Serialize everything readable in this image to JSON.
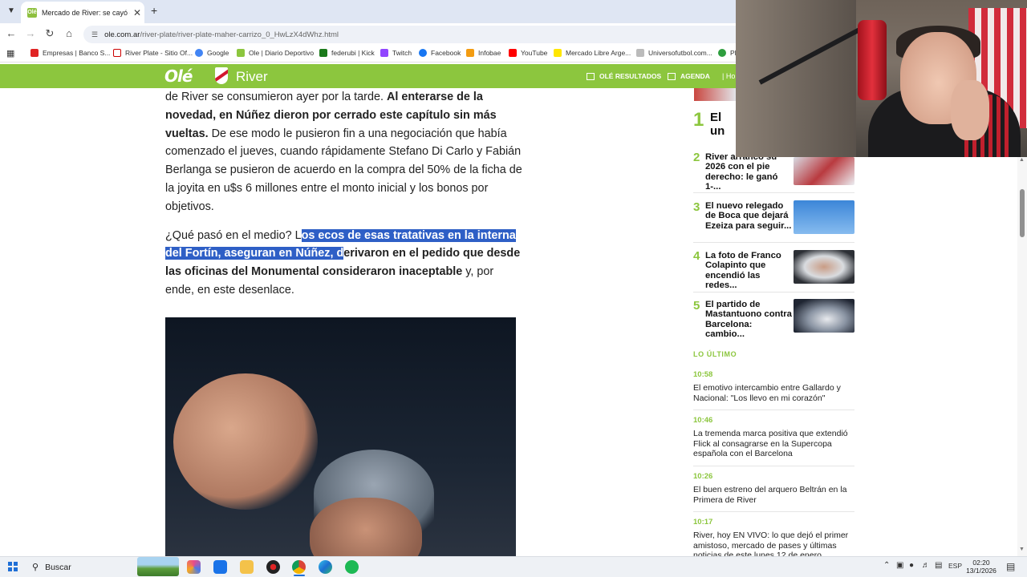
{
  "browser": {
    "tab_title": "Mercado de River: se cayó el pa",
    "tab_favicon": "Olé",
    "url_domain": "ole.com.ar",
    "url_path": "/river-plate/river-plate-maher-carrizo_0_HwLzX4dWhz.html",
    "bookmarks": [
      {
        "label": "Empresas | Banco S...",
        "color": "#e02424"
      },
      {
        "label": "River Plate - Sitio Of...",
        "color": "#ffffff"
      },
      {
        "label": "Google",
        "color": "#4285f4"
      },
      {
        "label": "Ole | Diario Deportivo",
        "color": "#8cc63e"
      },
      {
        "label": "federubi | Kick",
        "color": "#1b7a1b"
      },
      {
        "label": "Twitch",
        "color": "#9146ff"
      },
      {
        "label": "Facebook",
        "color": "#1877f2"
      },
      {
        "label": "Infobae",
        "color": "#f39c12"
      },
      {
        "label": "YouTube",
        "color": "#ff0000"
      },
      {
        "label": "Mercado Libre Arge...",
        "color": "#ffe600"
      },
      {
        "label": "Universofutbol.com...",
        "color": "#777777"
      },
      {
        "label": "PF",
        "color": "#2e9e3e"
      }
    ]
  },
  "site": {
    "logo": "Olé",
    "section": "River",
    "nav": {
      "resultados": "OLÉ RESULTADOS",
      "agenda": "AGENDA",
      "extra": "| Ho"
    }
  },
  "article": {
    "p1_a": "de River se consumieron ayer por la tarde. ",
    "p1_b": "Al enterarse de la novedad, en Núñez dieron por cerrado este capítulo sin más vueltas.",
    "p1_c": " De ese modo le pusieron fin a una negociación que había comenzado el jueves, cuando rápidamente Stefano Di Carlo y Fabián Berlanga se pusieron de acuerdo en la compra del 50% de la ficha de la joyita en u$s 6 millones entre el monto inicial y los bonos por objetivos.",
    "p2_a": "¿Qué pasó en el medio? L",
    "p2_sel": "os ecos de esas tratativas en la interna del Fortín, aseguran en Núñez, d",
    "p2_b": "erivaron en el pedido que desde las oficinas del Monumental consideraron inaceptable",
    "p2_c": " y, por ende, en este desenlace."
  },
  "sidebar": {
    "ranked": [
      {
        "num": "1",
        "title": "El un ante"
      },
      {
        "num": "2",
        "title": "River arrancó su 2026 con el pie derecho: le ganó 1-..."
      },
      {
        "num": "3",
        "title": "El nuevo relegado de Boca que dejará Ezeiza para seguir..."
      },
      {
        "num": "4",
        "title": "La foto de Franco Colapinto que encendió las redes..."
      },
      {
        "num": "5",
        "title": "El partido de Mastantuono contra Barcelona: cambio..."
      }
    ],
    "lo_ultimo_label": "LO ÚLTIMO",
    "latest": [
      {
        "time": "10:58",
        "title": "El emotivo intercambio entre Gallardo y Nacional: \"Los llevo en mi corazón\""
      },
      {
        "time": "10:46",
        "title": "La tremenda marca positiva que extendió Flick al consagrarse en la Supercopa española con el Barcelona"
      },
      {
        "time": "10:26",
        "title": "El buen estreno del arquero Beltrán en la Primera de River"
      },
      {
        "time": "10:17",
        "title": "River, hoy EN VIVO: lo que dejó el primer amistoso, mercado de pases y últimas noticias de este lunes 12 de enero"
      }
    ]
  },
  "taskbar": {
    "search_label": "Buscar",
    "language": "ESP",
    "time": "02:20",
    "date": "13/1/2026"
  },
  "colors": {
    "brand_green": "#8cc63e",
    "selection_blue": "#2e5fc6"
  },
  "icons": [
    "tab-list-icon",
    "close-icon",
    "plus-icon",
    "back-icon",
    "forward-icon",
    "reload-icon",
    "home-icon",
    "site-settings-icon",
    "apps-grid-icon",
    "chart-icon",
    "calendar-icon",
    "windows-start-icon",
    "search-icon",
    "notification-icon"
  ]
}
